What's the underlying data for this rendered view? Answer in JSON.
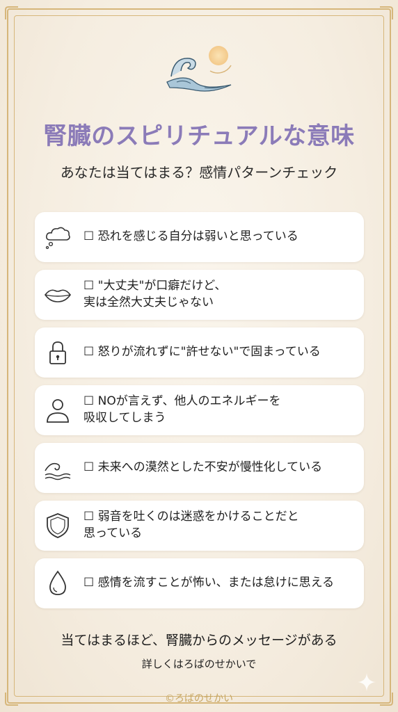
{
  "header": {
    "title": "腎臓のスピリチュアルな意味",
    "subtitle": "あなたは当てはまる？感情パターンチェック"
  },
  "checklist": [
    {
      "icon": "thought-cloud-icon",
      "text": "☐ 恐れを感じる自分は弱いと思っている"
    },
    {
      "icon": "lips-icon",
      "text": "☐ \"大丈夫\"が口癖だけど、\n実は全然大丈夫じゃない"
    },
    {
      "icon": "padlock-icon",
      "text": "☐ 怒りが流れずに\"許せない\"で固まっている"
    },
    {
      "icon": "person-icon",
      "text": "☐ NOが言えず、他人のエネルギーを\n吸収してしまう"
    },
    {
      "icon": "wave-icon",
      "text": "☐ 未来への漠然とした不安が慢性化している"
    },
    {
      "icon": "shield-icon",
      "text": "☐ 弱音を吐くのは迷惑をかけることだと\n思っている"
    },
    {
      "icon": "water-drop-icon",
      "text": "☐ 感情を流すことが怖い、または怠けに思える"
    }
  ],
  "footer": {
    "main": "当てはまるほど、腎臓からのメッセージがある",
    "sub": "詳しくはろばのせかいで",
    "credit": "©ろばのせかい"
  },
  "colors": {
    "background": "#f5ede0",
    "frame": "#d6b67a",
    "title": "#8b7bb8",
    "card": "#ffffff"
  }
}
